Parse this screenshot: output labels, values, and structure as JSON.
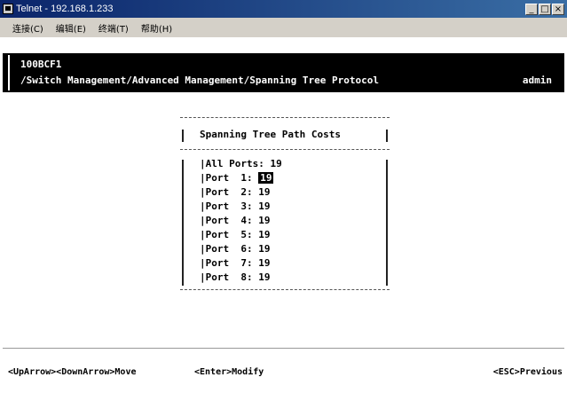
{
  "window": {
    "title": "Telnet - 192.168.1.233",
    "minimize": "_",
    "maximize": "□",
    "close": "×"
  },
  "menu": {
    "items": [
      "连接(C)",
      "编辑(E)",
      "终端(T)",
      "帮助(H)"
    ]
  },
  "header": {
    "device": "100BCF1",
    "path": "/Switch Management/Advanced Management/Spanning Tree Protocol",
    "user": "admin"
  },
  "dialog": {
    "title": "Spanning Tree Path Costs",
    "all_ports_label": "All Ports:",
    "all_ports_value": "19",
    "ports": [
      {
        "label": "Port  1:",
        "value": "19"
      },
      {
        "label": "Port  2:",
        "value": "19"
      },
      {
        "label": "Port  3:",
        "value": "19"
      },
      {
        "label": "Port  4:",
        "value": "19"
      },
      {
        "label": "Port  5:",
        "value": "19"
      },
      {
        "label": "Port  6:",
        "value": "19"
      },
      {
        "label": "Port  7:",
        "value": "19"
      },
      {
        "label": "Port  8:",
        "value": "19"
      }
    ]
  },
  "footer": {
    "nav_hint": "<UpArrow><DownArrow>Move",
    "enter_hint": "<Enter>Modify",
    "esc_hint": "<ESC>Previous"
  }
}
